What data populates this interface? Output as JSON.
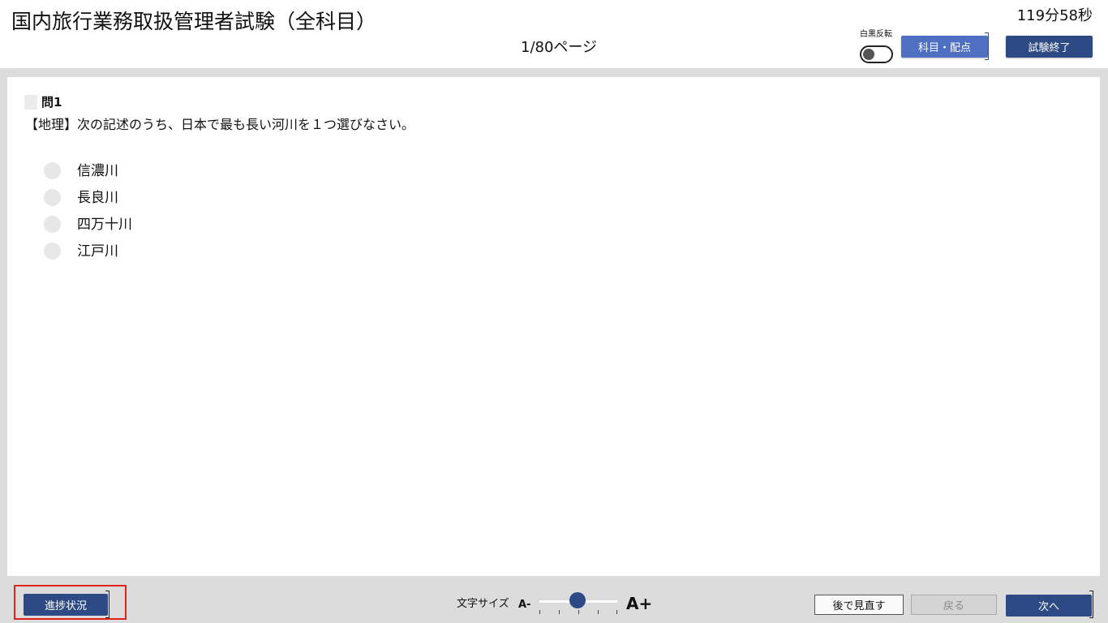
{
  "header": {
    "title": "国内旅行業務取扱管理者試験（全科目）",
    "timer": "119分58秒",
    "page_counter": "1/80ページ",
    "invert_toggle": {
      "label": "白黒反転",
      "state": "off"
    },
    "subject_button": "科目・配点",
    "end_button": "試験終了"
  },
  "question": {
    "number": "問1",
    "text": "【地理】次の記述のうち、日本で最も長い河川を１つ選びなさい。",
    "choices": [
      {
        "label": "信濃川",
        "selected": false
      },
      {
        "label": "長良川",
        "selected": false
      },
      {
        "label": "四万十川",
        "selected": false
      },
      {
        "label": "江戸川",
        "selected": false
      }
    ]
  },
  "footer": {
    "progress_button": "進捗状況",
    "font_size": {
      "label": "文字サイズ",
      "decrease": "A-",
      "increase": "A+",
      "level": 0.5
    },
    "review_button": "後で見直す",
    "back_button": "戻る",
    "next_button": "次へ"
  },
  "colors": {
    "primary_button": "#2e4a84",
    "subject_button": "#4e6fc2",
    "highlight_border": "#e2231a",
    "frame_gray": "#dcdcdc"
  }
}
